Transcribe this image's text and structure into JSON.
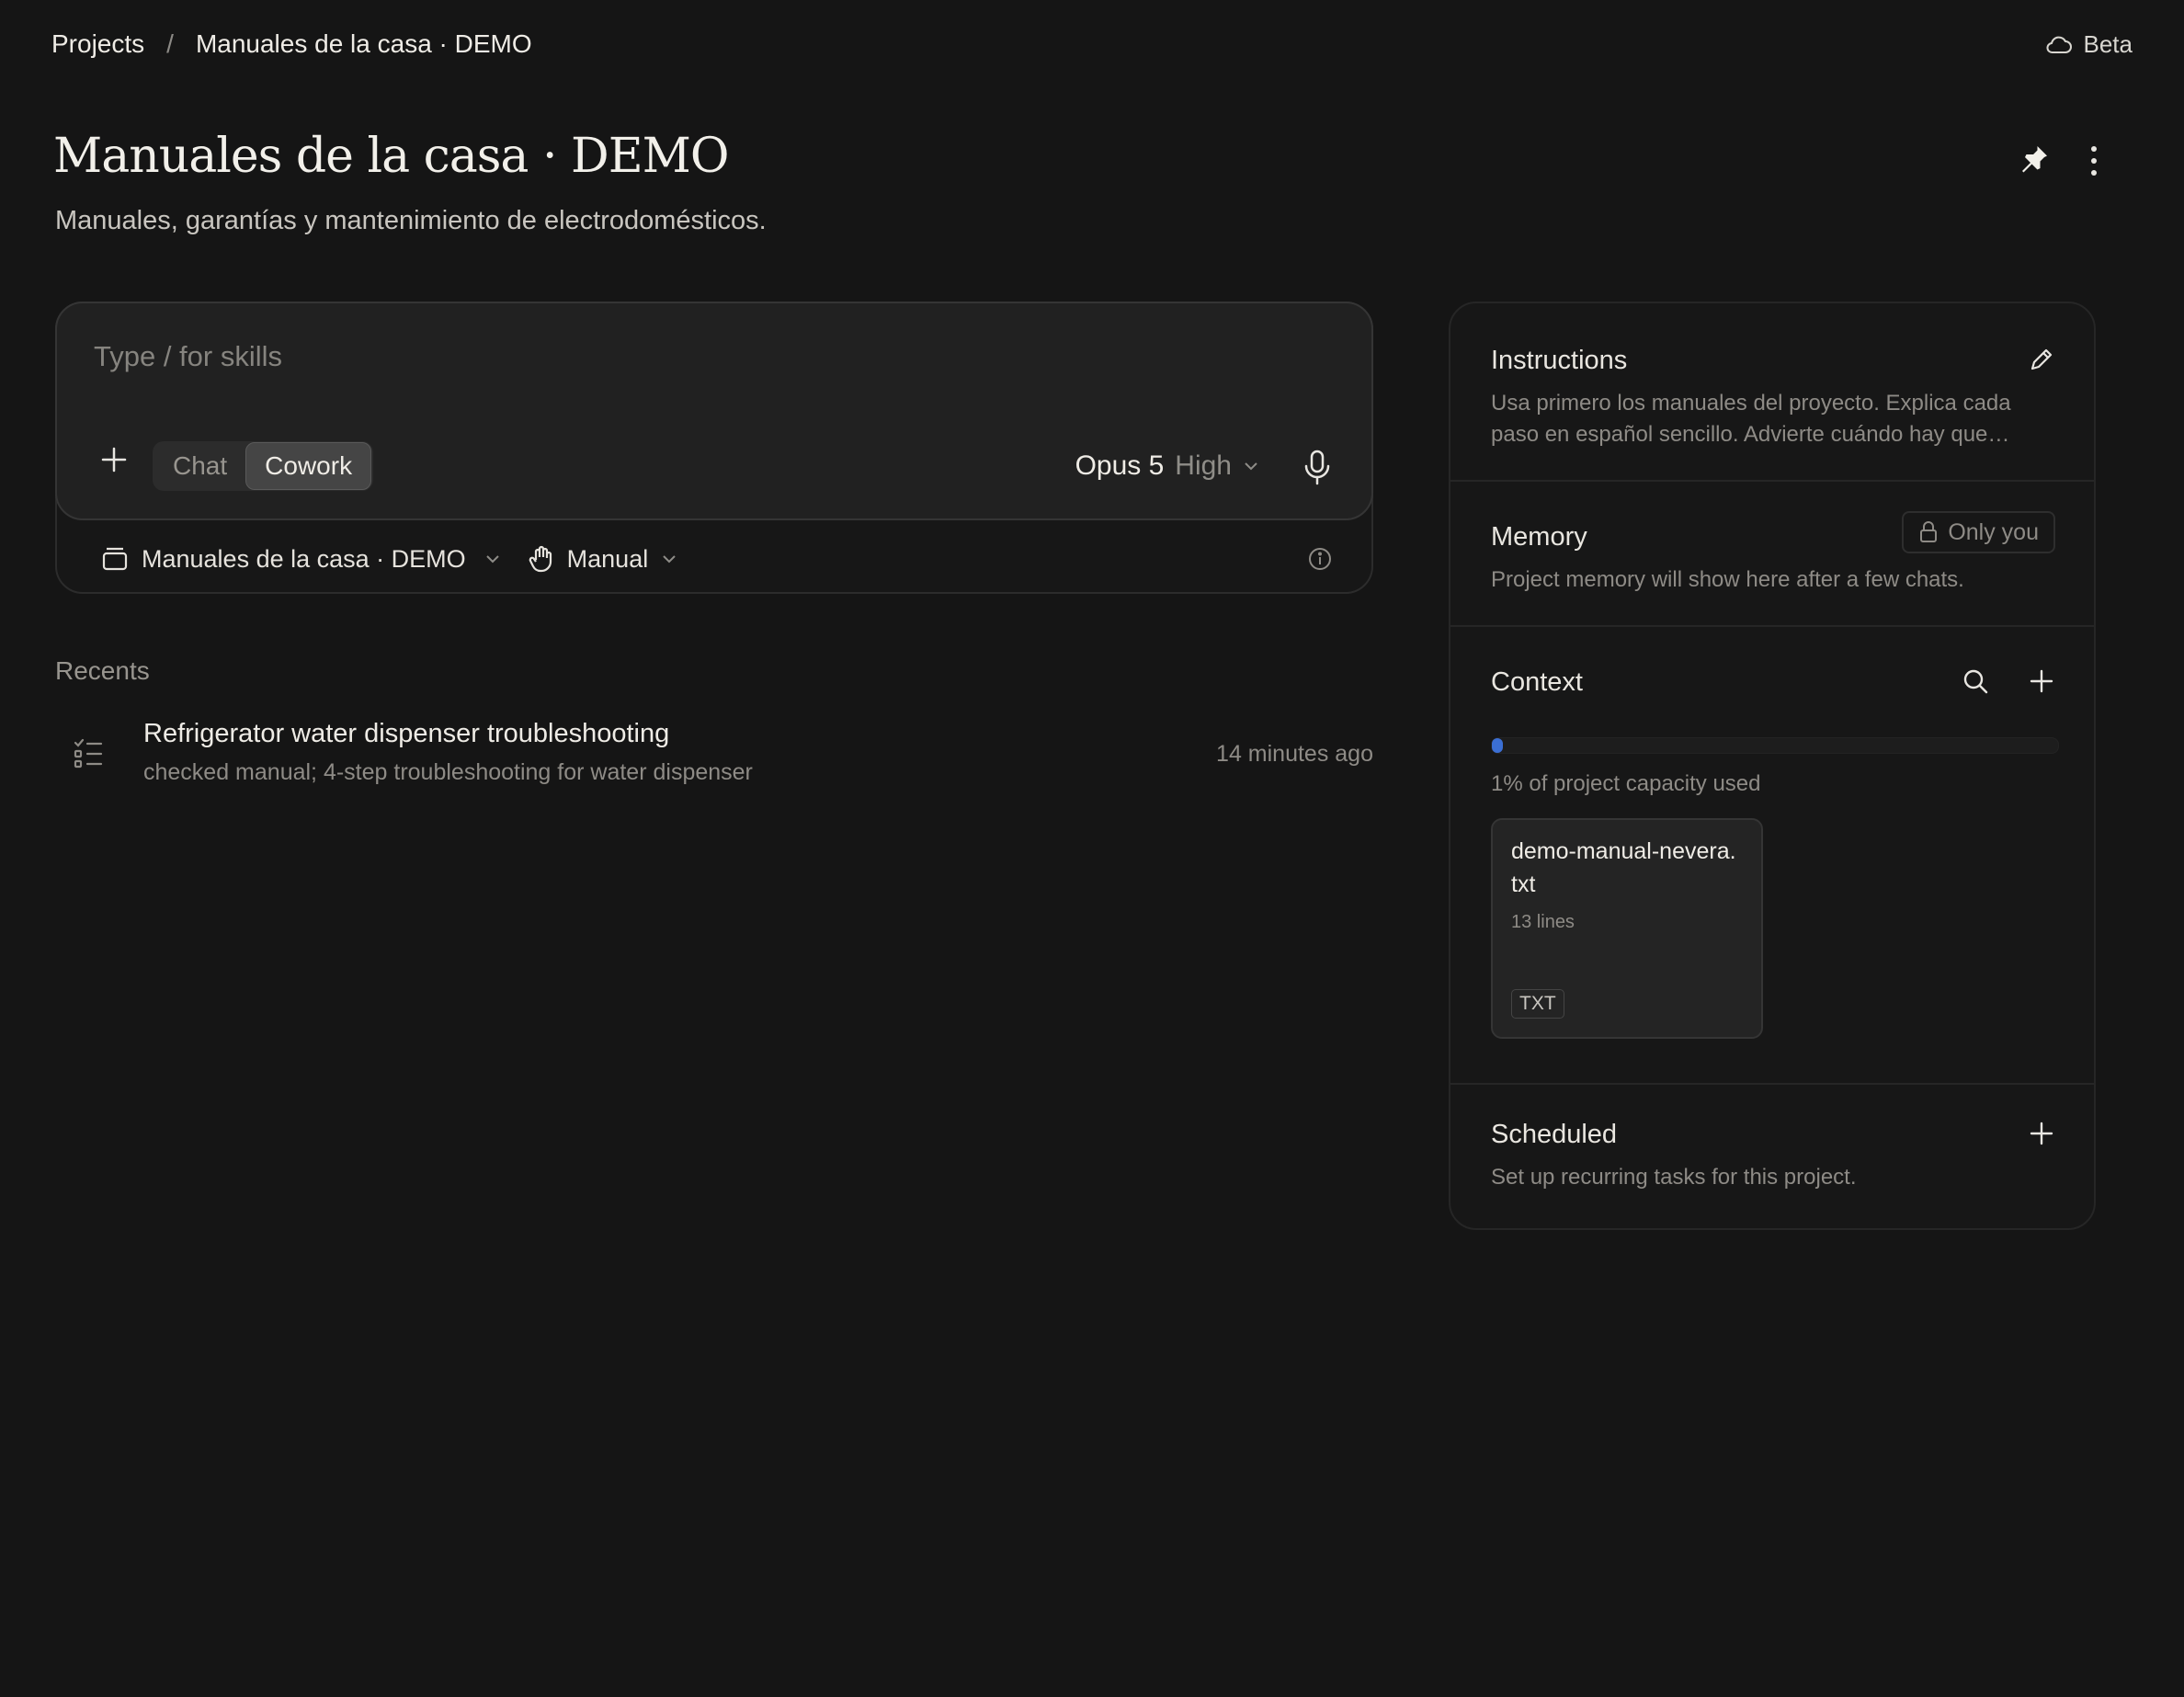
{
  "breadcrumb": {
    "root": "Projects",
    "separator": "/",
    "current": "Manuales de la casa · DEMO"
  },
  "beta": {
    "label": "Beta",
    "icon": "cloud-icon"
  },
  "header": {
    "title": "Manuales de la casa · DEMO",
    "subtitle": "Manuales, garantías y mantenimiento de electrodomésticos.",
    "pin_icon": "pin-icon",
    "more_icon": "more-vertical-icon"
  },
  "composer": {
    "placeholder": "Type / for skills",
    "add_icon": "plus-icon",
    "modes": [
      "Chat",
      "Cowork"
    ],
    "selected_mode": "Cowork",
    "model": "Opus 5",
    "effort": "High",
    "mic_icon": "microphone-icon",
    "project_selector": "Manuales de la casa · DEMO",
    "permission_mode": "Manual",
    "info_icon": "info-icon"
  },
  "recents": {
    "heading": "Recents",
    "items": [
      {
        "title": "Refrigerator water dispenser troubleshooting",
        "summary": "checked manual; 4-step troubleshooting for water dispenser",
        "time": "14 minutes ago",
        "icon": "task-list-icon"
      }
    ]
  },
  "panel": {
    "instructions": {
      "title": "Instructions",
      "text_line1": "Usa primero los manuales del proyecto. Explica cada",
      "text_line2": "paso en español sencillo. Advierte cuándo hay que…"
    },
    "memory": {
      "title": "Memory",
      "visibility": "Only you",
      "text": "Project memory will show here after a few chats."
    },
    "context": {
      "title": "Context",
      "capacity_used_fraction": 0.01,
      "capacity_text": "1% of project capacity used",
      "files": [
        {
          "name": "demo-manual-nevera.txt",
          "lines": "13 lines",
          "type": "TXT"
        }
      ]
    },
    "scheduled": {
      "title": "Scheduled",
      "text": "Set up recurring tasks for this project."
    }
  },
  "colors": {
    "background": "#151515",
    "accent": "#3b6fd4"
  }
}
